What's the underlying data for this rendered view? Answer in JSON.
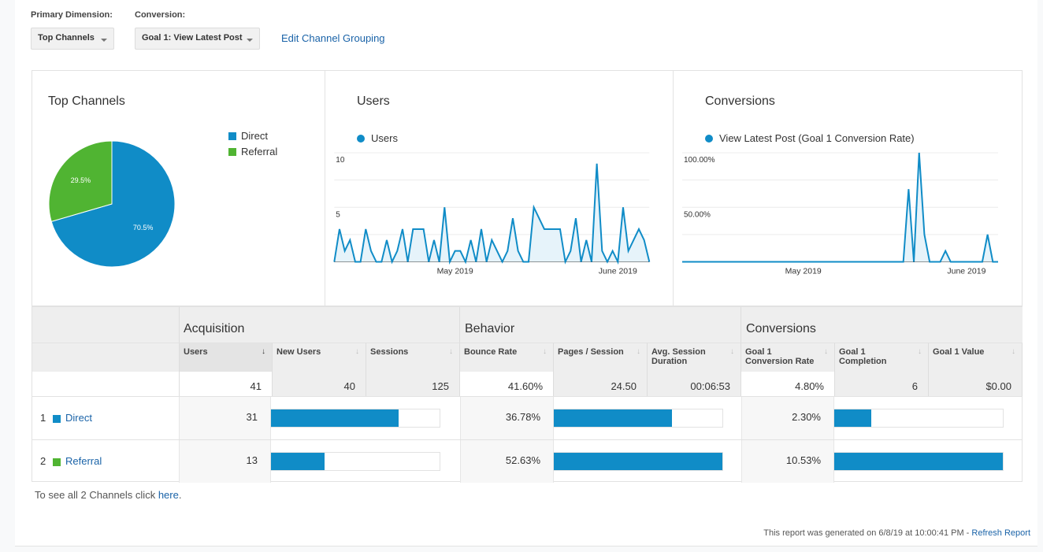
{
  "controls": {
    "primary_dimension_label": "Primary Dimension:",
    "primary_dimension_value": "Top Channels",
    "conversion_label": "Conversion:",
    "conversion_value": "Goal 1: View Latest Post",
    "edit_grouping_link": "Edit Channel Grouping"
  },
  "colors": {
    "direct": "#108cc7",
    "referral": "#50b432",
    "line": "#108cc7",
    "area": "#e6f3fa",
    "link": "#1a63a8"
  },
  "chart_data": [
    {
      "type": "pie",
      "title": "Top Channels",
      "legend_position": "right",
      "slices": [
        {
          "label": "Direct",
          "value": 70.5,
          "display": "70.5%"
        },
        {
          "label": "Referral",
          "value": 29.5,
          "display": "29.5%"
        }
      ]
    },
    {
      "type": "area",
      "title": "Users",
      "legend": [
        "Users"
      ],
      "x_start": "2019-04-08",
      "x_end": "2019-06-07",
      "x_tick_labels": [
        {
          "index": 23,
          "label": "May 2019"
        },
        {
          "index": 54,
          "label": "June 2019"
        }
      ],
      "y_tick_labels": [
        {
          "value": 10,
          "label": "10"
        },
        {
          "value": 5,
          "label": "5"
        }
      ],
      "ylim": [
        0,
        10
      ],
      "grid": true,
      "values": [
        0,
        3,
        1,
        2,
        0,
        0,
        3,
        1,
        0,
        0,
        2,
        0,
        1,
        3,
        0,
        3,
        3,
        3,
        0,
        2,
        0,
        5,
        0,
        1,
        1,
        0,
        2,
        0,
        3,
        0,
        2,
        1,
        0,
        1,
        4,
        1,
        0,
        0,
        5,
        4,
        3,
        3,
        3,
        3,
        0,
        1,
        4,
        0,
        2,
        0,
        9,
        1,
        0,
        1,
        0,
        5,
        1,
        2,
        3,
        2,
        0
      ]
    },
    {
      "type": "area",
      "title": "Conversions",
      "legend": [
        "View Latest Post (Goal 1 Conversion Rate)"
      ],
      "x_start": "2019-04-08",
      "x_end": "2019-06-07",
      "x_tick_labels": [
        {
          "index": 23,
          "label": "May 2019"
        },
        {
          "index": 54,
          "label": "June 2019"
        }
      ],
      "y_tick_labels": [
        {
          "value": 100,
          "label": "100.00%"
        },
        {
          "value": 50,
          "label": "50.00%"
        }
      ],
      "ylim": [
        0,
        100
      ],
      "grid": true,
      "values": [
        0,
        0,
        0,
        0,
        0,
        0,
        0,
        0,
        0,
        0,
        0,
        0,
        0,
        0,
        0,
        0,
        0,
        0,
        0,
        0,
        0,
        0,
        0,
        0,
        0,
        0,
        0,
        0,
        0,
        0,
        0,
        0,
        0,
        0,
        0,
        0,
        0,
        0,
        0,
        0,
        0,
        0,
        0,
        66.67,
        0,
        100,
        25,
        0,
        0,
        0,
        10,
        0,
        0,
        0,
        0,
        0,
        0,
        0,
        25,
        0,
        0
      ]
    }
  ],
  "table": {
    "groups": [
      "Acquisition",
      "Behavior",
      "Conversions"
    ],
    "columns": [
      "Users",
      "New Users",
      "Sessions",
      "Bounce Rate",
      "Pages / Session",
      "Avg. Session Duration",
      "Goal 1 Conversion Rate",
      "Goal 1 Completion",
      "Goal 1 Value"
    ],
    "sort_icon": "arrow-down-icon",
    "totals": [
      "41",
      "40",
      "125",
      "41.60%",
      "24.50",
      "00:06:53",
      "4.80%",
      "6",
      "$0.00"
    ],
    "rows": [
      {
        "rank": "1",
        "channel": "Direct",
        "color": "#108cc7",
        "users": "31",
        "users_bar": 0.756,
        "bounce_rate": "36.78%",
        "bounce_bar": 0.699,
        "conv_rate": "2.30%",
        "conv_bar": 0.218
      },
      {
        "rank": "2",
        "channel": "Referral",
        "color": "#50b432",
        "users": "13",
        "users_bar": 0.317,
        "bounce_rate": "52.63%",
        "bounce_bar": 1.0,
        "conv_rate": "10.53%",
        "conv_bar": 1.0
      }
    ]
  },
  "see_all": {
    "prefix": "To see all 2 Channels click ",
    "link": "here",
    "suffix": "."
  },
  "footer": {
    "generated": "This report was generated on 6/8/19 at 10:00:41 PM - ",
    "refresh_link": "Refresh Report"
  }
}
